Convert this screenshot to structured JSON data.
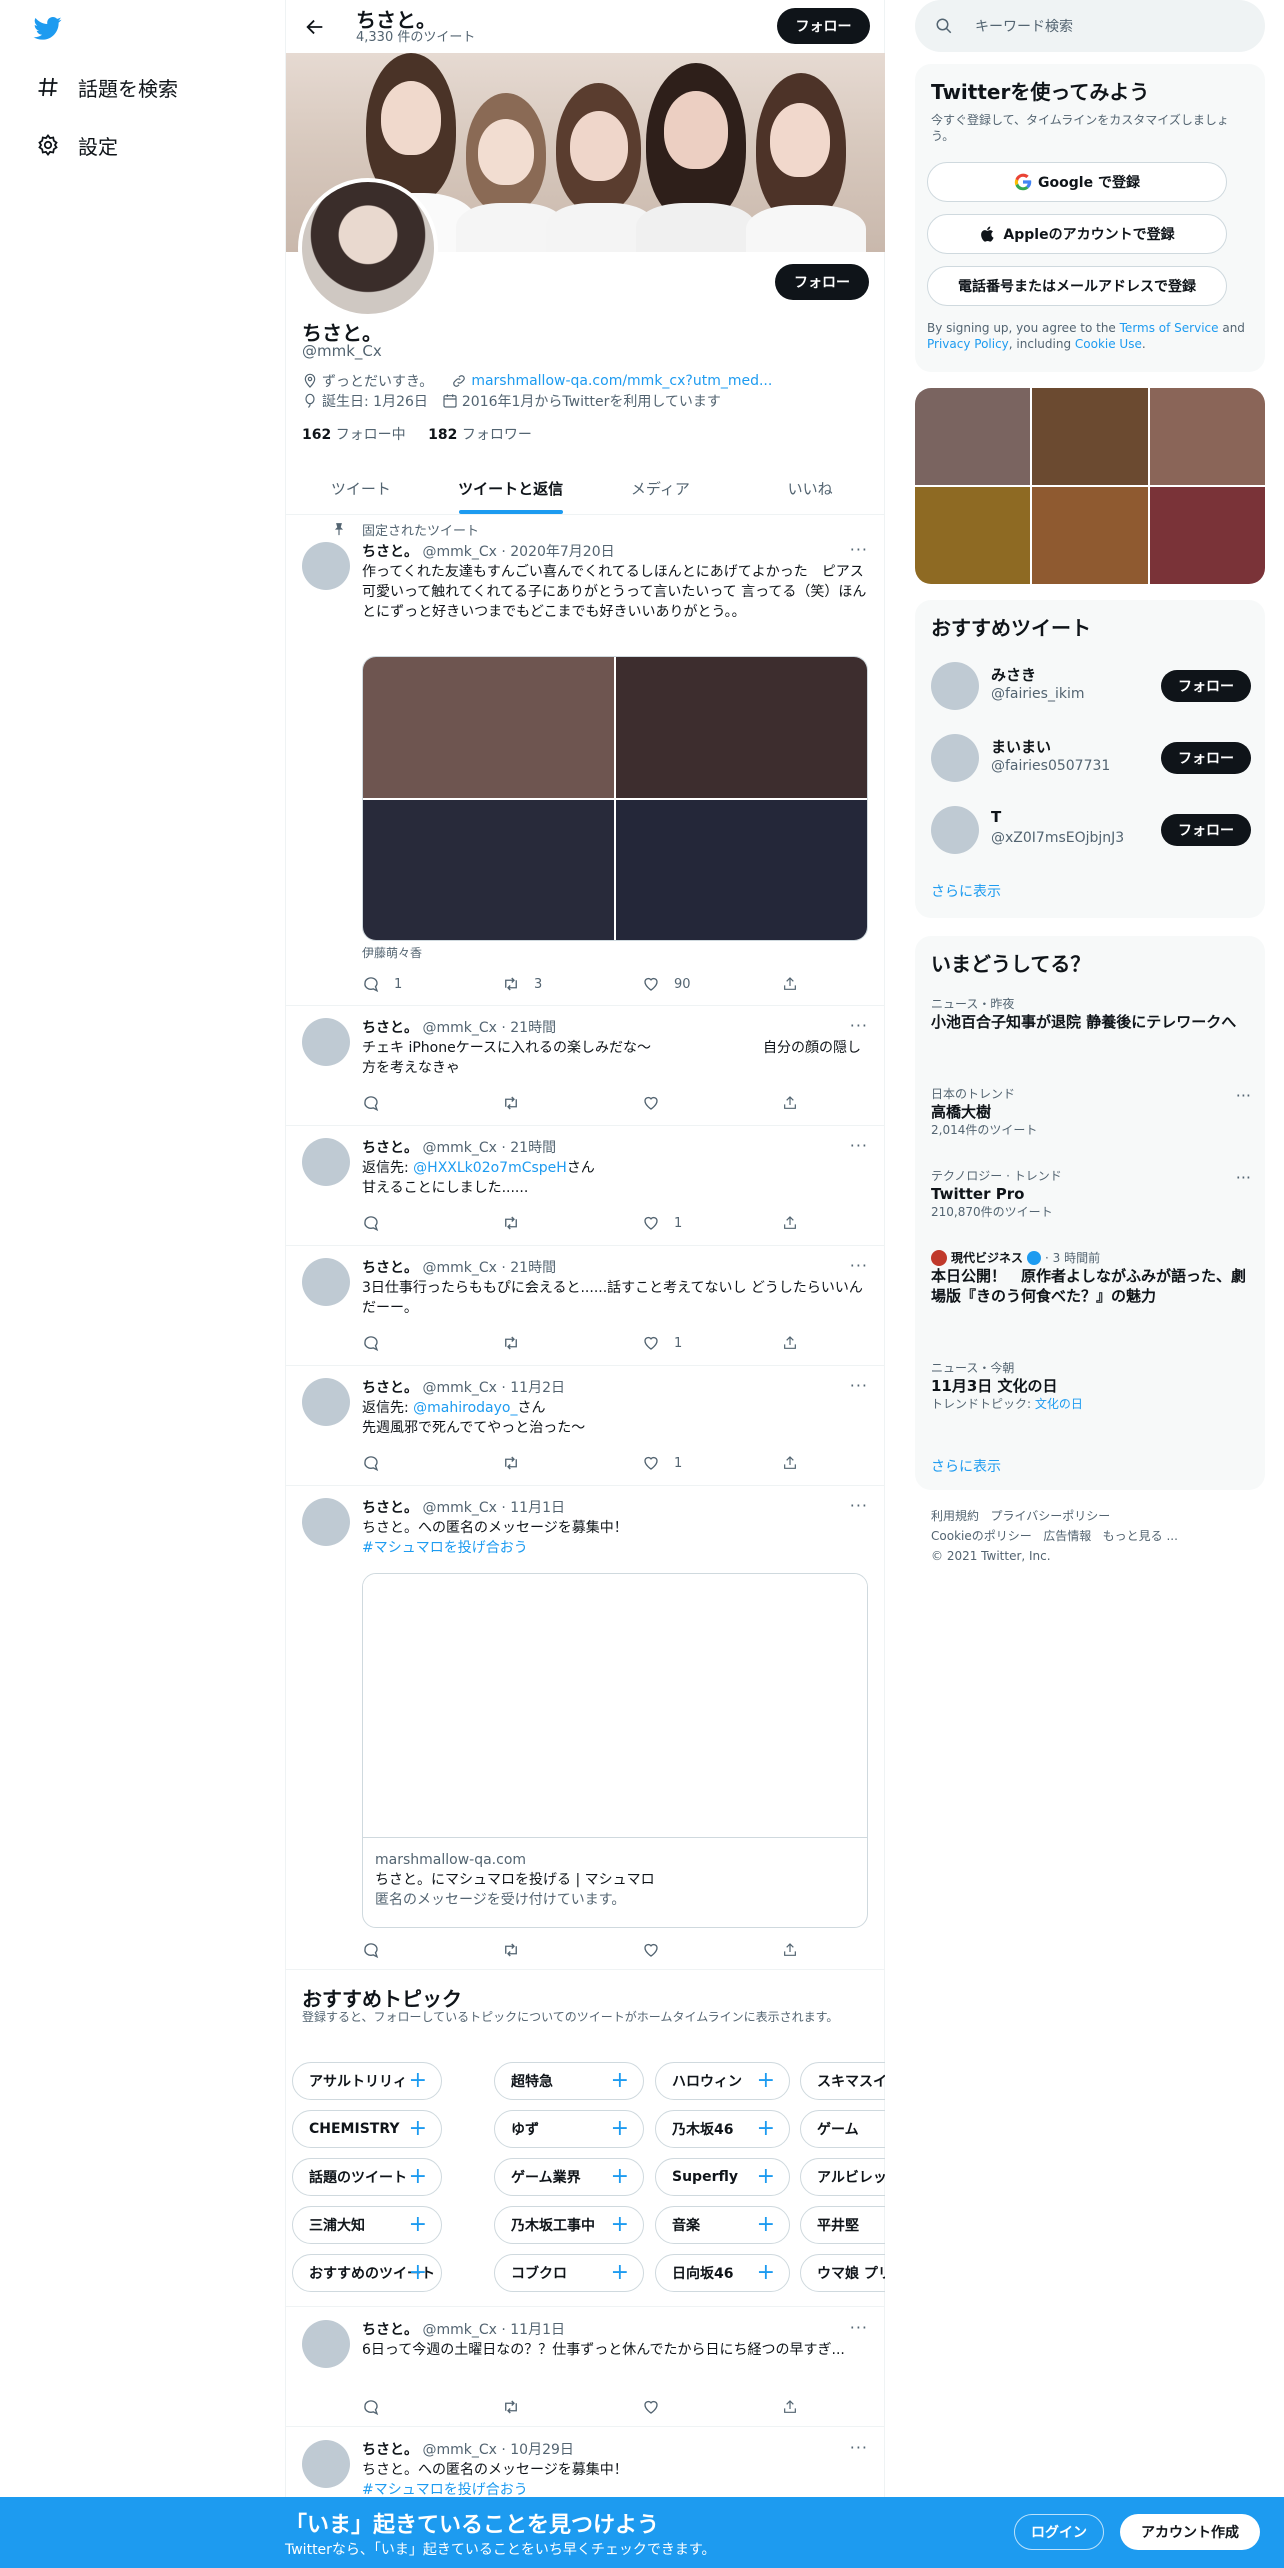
{
  "nav": {
    "explore": "話題を検索",
    "settings": "設定"
  },
  "header": {
    "name": "ちさと。",
    "tweet_count": "4,330 件のツイート",
    "follow": "フォロー"
  },
  "profile": {
    "name": "ちさと。",
    "handle": "@mmk_Cx",
    "follow_button": "フォロー",
    "location": "ずっとだいすき。",
    "url": "marshmallow-qa.com/mmk_cx?utm_med...",
    "birthday": "誕生日: 1月26日",
    "joined": "2016年1月からTwitterを利用しています",
    "following_count": "162",
    "following_label": "フォロー中",
    "followers_count": "182",
    "followers_label": "フォロワー"
  },
  "tabs": [
    "ツイート",
    "ツイートと返信",
    "メディア",
    "いいね"
  ],
  "pinned_label": "固定されたツイート",
  "tweets": [
    {
      "name": "ちさと。",
      "handle": "@mmk_Cx",
      "time": "· 2020年7月20日",
      "text": "作ってくれた友達もすんごい喜んでくれてるしほんとにあげてよかった　ピアス可愛いって触れてくれてる子にありがとうって言いたいって 言ってる（笑）ほんとにずっと好きいつまでもどこまでも好きいいありがとう。。",
      "media_caption": "伊藤萌々香",
      "replies": "1",
      "retweets": "3",
      "likes": "90"
    },
    {
      "name": "ちさと。",
      "handle": "@mmk_Cx",
      "time": "· 21時間",
      "text": "チェキ iPhoneケースに入れるの楽しみだな〜　　　　　　　　自分の顔の隠し方を考えなきゃ",
      "replies": "",
      "retweets": "",
      "likes": ""
    },
    {
      "name": "ちさと。",
      "handle": "@mmk_Cx",
      "time": "· 21時間",
      "reply_prefix": "返信先:",
      "reply_to": "@HXXLk02o7mCspeH",
      "reply_suffix": "さん",
      "text": "甘えることにしました......",
      "replies": "",
      "retweets": "",
      "likes": "1"
    },
    {
      "name": "ちさと。",
      "handle": "@mmk_Cx",
      "time": "· 21時間",
      "text": "3日仕事行ったらももぴに会えると......話すこと考えてないし どうしたらいいんだーー。",
      "replies": "",
      "retweets": "",
      "likes": "1"
    },
    {
      "name": "ちさと。",
      "handle": "@mmk_Cx",
      "time": "· 11月2日",
      "reply_prefix": "返信先:",
      "reply_to": "@mahirodayo_",
      "reply_suffix": "さん",
      "text": "先週風邪で死んでてやっと治った〜",
      "replies": "",
      "retweets": "",
      "likes": "1"
    },
    {
      "name": "ちさと。",
      "handle": "@mmk_Cx",
      "time": "· 11月1日",
      "text": "ちさと。への匿名のメッセージを募集中！",
      "hashtag": "#マシュマロを投げ合おう",
      "card_domain": "marshmallow-qa.com",
      "card_title": "ちさと。にマシュマロを投げる | マシュマロ",
      "card_desc": "匿名のメッセージを受け付けています。",
      "replies": "",
      "retweets": "",
      "likes": ""
    },
    {
      "name": "ちさと。",
      "handle": "@mmk_Cx",
      "time": "· 11月1日",
      "text": "6日って今週の土曜日なの？？仕事ずっと休んでたから日にち経つの早すぎ...",
      "replies": "",
      "retweets": "",
      "likes": ""
    },
    {
      "name": "ちさと。",
      "handle": "@mmk_Cx",
      "time": "· 10月29日",
      "text": "ちさと。への匿名のメッセージを募集中！",
      "hashtag": "#マシュマロを投げ合おう"
    }
  ],
  "topics": {
    "title": "おすすめトピック",
    "subtitle": "登録すると、フォローしているトピックについてのツイートがホームタイムラインに表示されます。",
    "rows": [
      [
        "アサルトリリィ",
        "超特急",
        "ハロウィン",
        "スキマスイッチ"
      ],
      [
        "CHEMISTRY",
        "ゆず",
        "乃木坂46",
        "ゲーム"
      ],
      [
        "話題のツイート",
        "ゲーム業界",
        "Superfly",
        "アルビレックス"
      ],
      [
        "三浦大知",
        "乃木坂工事中",
        "音楽",
        "平井堅"
      ],
      [
        "おすすめのツイート",
        "コブクロ",
        "日向坂46",
        "ウマ娘 プリティーダービー"
      ]
    ]
  },
  "search": {
    "placeholder": "キーワード検索"
  },
  "signup": {
    "title": "Twitterを使ってみよう",
    "subtitle": "今すぐ登録して、タイムラインをカスタマイズしましょう。",
    "google": "Google で登録",
    "apple": "Appleのアカウントで登録",
    "phone": "電話番号またはメールアドレスで登録",
    "legal_pre": "By signing up, you agree to the ",
    "tos": "Terms of Service",
    "legal_and": " and ",
    "privacy": "Privacy Policy",
    "legal_incl": ", including ",
    "cookie": "Cookie Use",
    "legal_end": "."
  },
  "who_to_follow": {
    "title": "おすすめツイート",
    "users": [
      {
        "name": "みさき",
        "handle": "@fairies_ikim",
        "button": "フォロー"
      },
      {
        "name": "まいまい",
        "handle": "@fairies0507731",
        "button": "フォロー"
      },
      {
        "name": "T",
        "handle": "@xZ0I7msEOjbjnJ3",
        "button": "フォロー"
      }
    ],
    "more": "さらに表示"
  },
  "trends": {
    "title": "いまどうしてる？",
    "items": [
      {
        "category": "ニュース・昨夜",
        "title": "小池百合子知事が退院 静養後にテレワークへ"
      },
      {
        "category": "日本のトレンド",
        "title": "高橋大樹",
        "count": "2,014件のツイート"
      },
      {
        "category": "テクノロジー · トレンド",
        "title": "Twitter Pro",
        "count": "210,870件のツイート"
      },
      {
        "source": "現代ビジネス",
        "time": "· 3 時間前",
        "title": "本日公開！　原作者よしながふみが語った、劇場版『きのう何食べた？』の魅力"
      },
      {
        "category": "ニュース・今朝",
        "title": "11月3日 文化の日",
        "topic_prefix": "トレンドトピック:",
        "topic": "文化の日"
      }
    ],
    "more": "さらに表示"
  },
  "footer": {
    "links": [
      "利用規約",
      "プライバシーポリシー",
      "Cookieのポリシー",
      "広告情報",
      "もっと見る ..."
    ],
    "copyright": "© 2021 Twitter, Inc."
  },
  "bottom_bar": {
    "title": "「いま」起きていることを見つけよう",
    "subtitle": "Twitterなら、「いま」起きていることをいち早くチェックできます。",
    "login": "ログイン",
    "signup": "アカウント作成"
  },
  "colors": {
    "accent": "#1d9bf0",
    "text": "#0f1419",
    "muted": "#536471",
    "dark_button": "#0f1419"
  }
}
